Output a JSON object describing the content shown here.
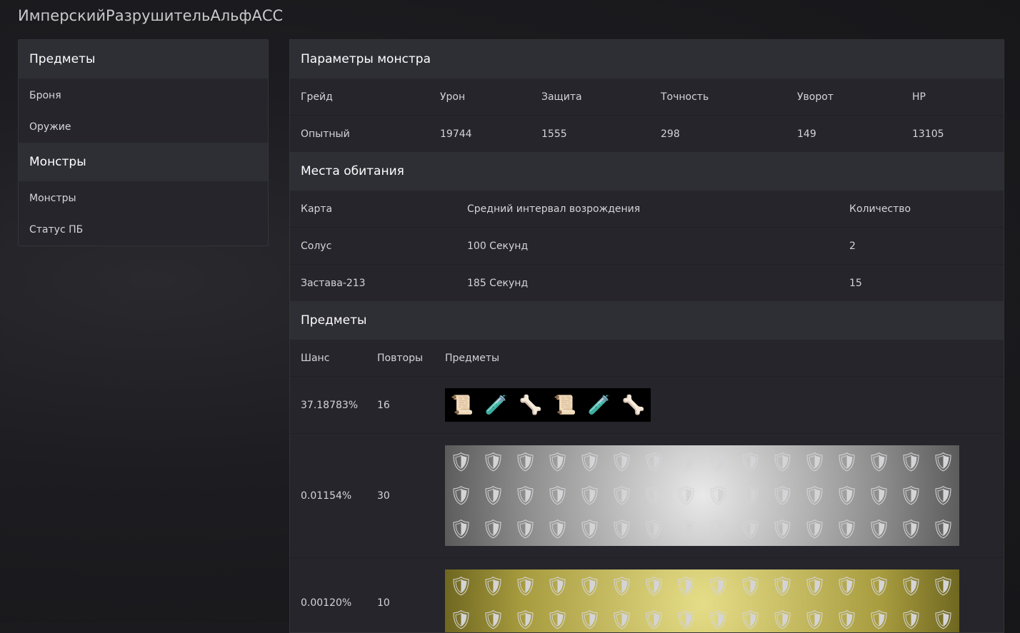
{
  "page_title": "ИмперскийРазрушительАльфАСС",
  "sidebar": {
    "sections": [
      {
        "title": "Предметы",
        "items": [
          "Броня",
          "Оружие"
        ]
      },
      {
        "title": "Монстры",
        "items": [
          "Монстры",
          "Статус ПБ"
        ]
      }
    ]
  },
  "params": {
    "title": "Параметры монстра",
    "headers": [
      "Грейд",
      "Урон",
      "Защита",
      "Точность",
      "Уворот",
      "HP"
    ],
    "values": [
      "Опытный",
      "19744",
      "1555",
      "298",
      "149",
      "13105"
    ]
  },
  "habitats": {
    "title": "Места обитания",
    "headers": [
      "Карта",
      "Средний интервал возрождения",
      "Количество"
    ],
    "rows": [
      [
        "Солус",
        "100 Секунд",
        "2"
      ],
      [
        "Застава-213",
        "185 Секунд",
        "15"
      ]
    ]
  },
  "drops": {
    "title": "Предметы",
    "headers": [
      "Шанс",
      "Повторы",
      "Предметы"
    ],
    "rows": [
      {
        "chance": "37.18783%",
        "repeats": "16",
        "icons": [
          "scroll-icon",
          "capsule-icon",
          "bone-icon",
          "scroll-icon",
          "capsule-icon",
          "bone-icon"
        ],
        "style": "dark"
      },
      {
        "chance": "0.01154%",
        "repeats": "30",
        "icons": [
          "armor-icon",
          "armor-icon",
          "armor-icon",
          "armor-icon",
          "armor-icon",
          "armor-icon",
          "armor-icon",
          "armor-icon",
          "armor-icon",
          "armor-icon",
          "armor-icon",
          "armor-icon",
          "armor-icon",
          "armor-icon",
          "armor-icon",
          "armor-icon",
          "armor-icon",
          "armor-icon",
          "armor-icon",
          "armor-icon",
          "armor-icon",
          "armor-icon",
          "armor-icon",
          "armor-icon",
          "armor-icon",
          "armor-icon",
          "armor-icon",
          "armor-icon",
          "armor-icon",
          "armor-icon",
          "armor-icon",
          "armor-icon",
          "armor-icon",
          "armor-icon",
          "armor-icon",
          "armor-icon",
          "armor-icon",
          "armor-icon",
          "armor-icon",
          "armor-icon",
          "armor-icon",
          "armor-icon",
          "armor-icon",
          "armor-icon",
          "armor-icon",
          "armor-icon",
          "armor-icon",
          "armor-icon"
        ],
        "style": "grey"
      },
      {
        "chance": "0.00120%",
        "repeats": "10",
        "icons": [
          "armor-icon",
          "armor-icon",
          "armor-icon",
          "armor-icon",
          "armor-icon",
          "armor-icon",
          "armor-icon",
          "armor-icon",
          "armor-icon",
          "armor-icon",
          "armor-icon",
          "armor-icon",
          "armor-icon",
          "armor-icon",
          "armor-icon",
          "armor-icon",
          "armor-icon",
          "armor-icon",
          "armor-icon",
          "armor-icon",
          "armor-icon",
          "armor-icon",
          "armor-icon",
          "armor-icon",
          "armor-icon",
          "armor-icon",
          "armor-icon",
          "armor-icon",
          "armor-icon",
          "armor-icon",
          "armor-icon",
          "armor-icon"
        ],
        "style": "gold"
      }
    ]
  },
  "icon_glyphs": {
    "scroll-icon": "📜",
    "capsule-icon": "🧪",
    "bone-icon": "🦴",
    "armor-icon": "🛡"
  }
}
